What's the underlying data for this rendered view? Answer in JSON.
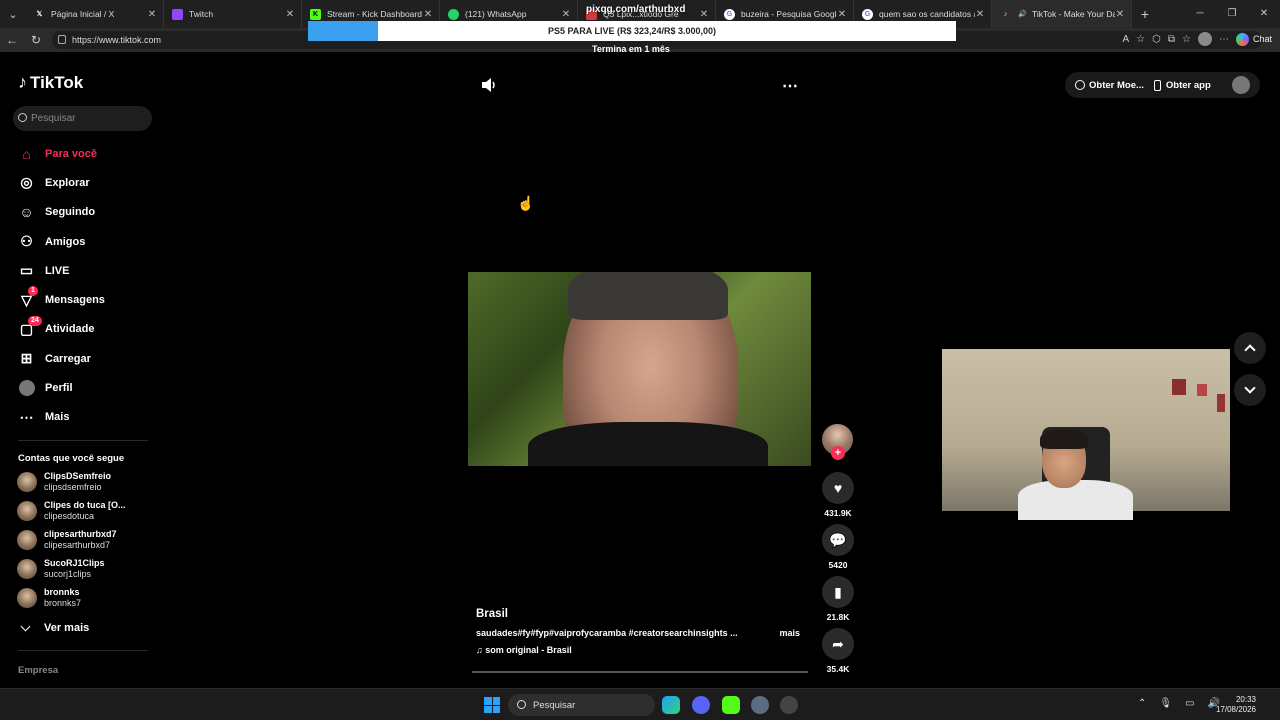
{
  "browser": {
    "tabs": [
      {
        "title": "Página Inicial / X",
        "favicon": "x-icon",
        "color": "#000000"
      },
      {
        "title": "Twitch",
        "favicon": "twitch-icon",
        "color": "#9146ff"
      },
      {
        "title": "Stream - Kick Dashboard",
        "favicon": "kick-icon",
        "color": "#53fc18"
      },
      {
        "title": "(121) WhatsApp",
        "favicon": "whatsapp-icon",
        "color": "#25d366"
      },
      {
        "title": "Q3 Lpix...xtiodo Gre",
        "favicon": "generic-icon",
        "color": "#d33a3a"
      },
      {
        "title": "buzeira - Pesquisa Google",
        "favicon": "google-icon",
        "color": "#4285f4"
      },
      {
        "title": "quem sao os candidatos a p",
        "favicon": "google-icon",
        "color": "#4285f4"
      },
      {
        "title": "TikTok - Make Your Day",
        "favicon": "tiktok-icon",
        "color": "#111111"
      }
    ],
    "url": "https://www.tiktok.com",
    "chat_label": "Chat"
  },
  "overlay": {
    "pixqg": "pixqg.com/arthurbxd",
    "goal_text": "PS5 PARA LIVE (R$ 323,24/R$ 3.000,00)",
    "goal_progress": 0.108,
    "ends_text": "Termina em 1 mês"
  },
  "tiktok": {
    "logo": "TikTok",
    "search_placeholder": "Pesquisar",
    "menu": [
      {
        "label": "Para você",
        "icon": "home-icon",
        "active": true
      },
      {
        "label": "Explorar",
        "icon": "compass-icon"
      },
      {
        "label": "Seguindo",
        "icon": "following-icon"
      },
      {
        "label": "Amigos",
        "icon": "friends-icon"
      },
      {
        "label": "LIVE",
        "icon": "live-icon"
      },
      {
        "label": "Mensagens",
        "icon": "message-icon",
        "badge": "1"
      },
      {
        "label": "Atividade",
        "icon": "activity-icon",
        "badge": "24"
      },
      {
        "label": "Carregar",
        "icon": "upload-icon"
      },
      {
        "label": "Perfil",
        "icon": "profile-icon"
      },
      {
        "label": "Mais",
        "icon": "more-icon"
      }
    ],
    "following_title": "Contas que você segue",
    "following": [
      {
        "name": "ClipsDSemfreio",
        "handle": "clipsdsemfreio"
      },
      {
        "name": "Clipes do tuca [O...",
        "handle": "clipesdotuca"
      },
      {
        "name": "clipesarthurbxd7",
        "handle": "clipesarthurbxd7"
      },
      {
        "name": "SucoRJ1Clips",
        "handle": "sucorj1clips"
      },
      {
        "name": "bronnks",
        "handle": "bronnks7"
      }
    ],
    "see_more": "Ver mais",
    "company": "Empresa",
    "get_coins": "Obter Moe...",
    "get_app": "Obter app",
    "video": {
      "author": "Brasil",
      "description": "saudades#fy#fyp#vaiprofycaramba #creatorsearchinsights ...",
      "more": "mais",
      "music": "som original - Brasil",
      "likes": "431.9K",
      "comments": "5420",
      "saves": "21.8K",
      "shares": "35.4K"
    }
  },
  "taskbar": {
    "search": "Pesquisar",
    "time": "20:33",
    "date": "17/08/2026"
  }
}
